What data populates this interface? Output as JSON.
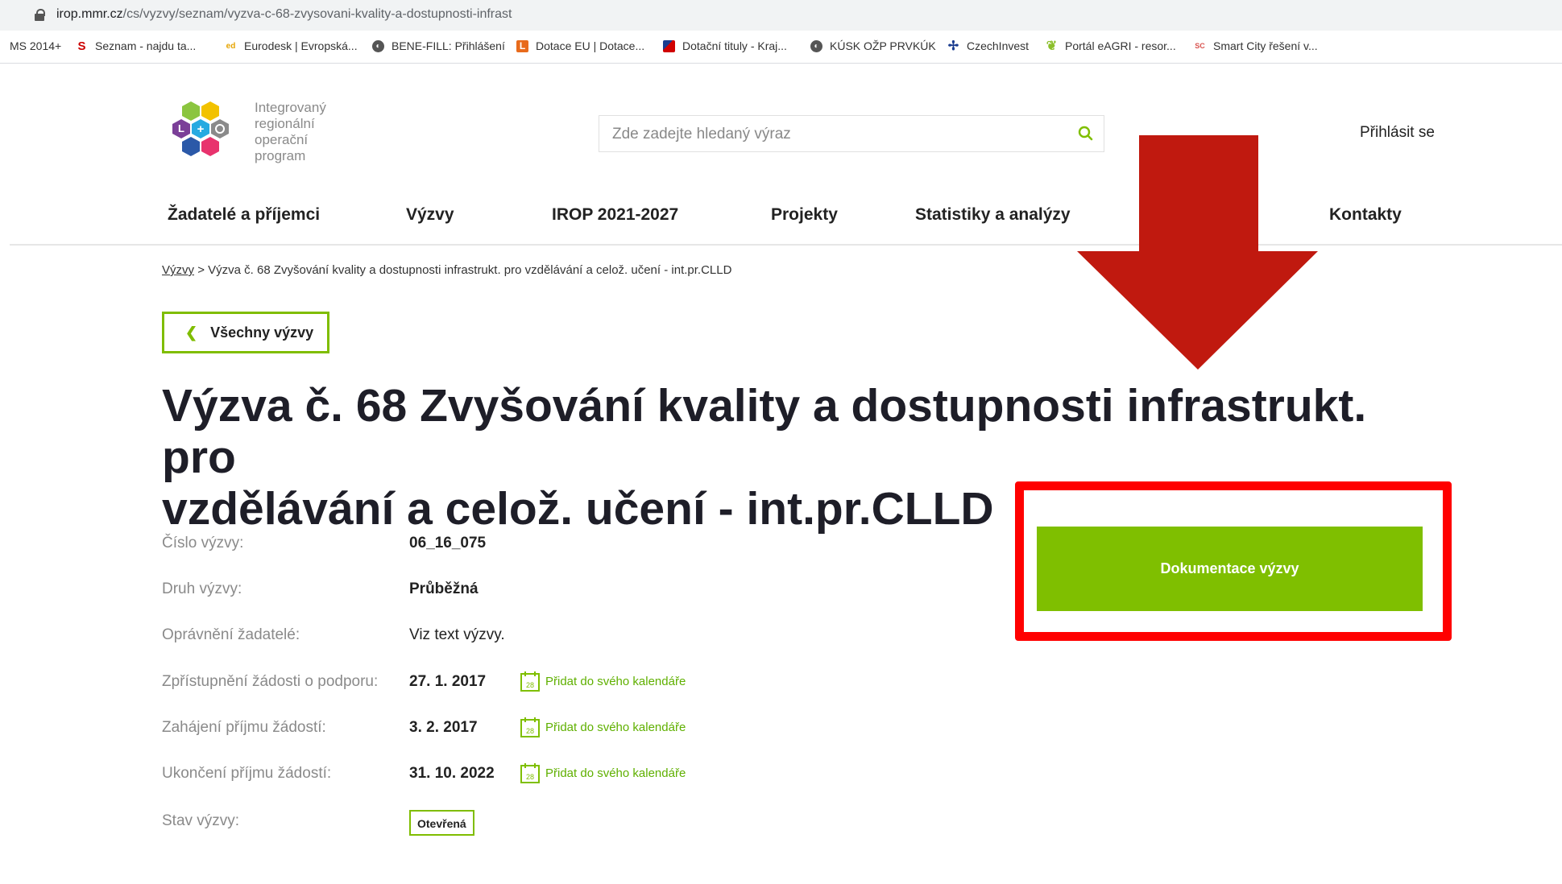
{
  "browser": {
    "url_host": "irop.mmr.cz",
    "url_path": "/cs/vyzvy/seznam/vyzva-c-68-zvysovani-kvality-a-dostupnosti-infrast"
  },
  "bookmarks": [
    {
      "label": "MS 2014+",
      "icon": "none",
      "color": ""
    },
    {
      "label": "Seznam - najdu ta...",
      "icon": "seznam-icon",
      "color": "#cc0000"
    },
    {
      "label": "Eurodesk | Evropská...",
      "icon": "eurodesk-icon",
      "color": "#e6a400"
    },
    {
      "label": "BENE-FILL: Přihlášení",
      "icon": "globe-icon",
      "color": "#555555"
    },
    {
      "label": "Dotace EU | Dotace...",
      "icon": "dotace-icon",
      "color": "#e86b1c"
    },
    {
      "label": "Dotační tituly - Kraj...",
      "icon": "kraj-flag-icon",
      "color": "#d00000"
    },
    {
      "label": "KÚSK OŽP PRVKÚK",
      "icon": "globe-icon",
      "color": "#555555"
    },
    {
      "label": "CzechInvest",
      "icon": "czechinvest-icon",
      "color": "#1a3c8f"
    },
    {
      "label": "Portál eAGRI - resor...",
      "icon": "eagri-icon",
      "color": "#8bbf2a"
    },
    {
      "label": "Smart City řešení v...",
      "icon": "smartcity-icon",
      "color": "#d9534f"
    }
  ],
  "header": {
    "logo_text": [
      "Integrovaný",
      "regionální",
      "operační",
      "program"
    ],
    "search_placeholder": "Zde zadejte hledaný výraz",
    "login": "Přihlásit se"
  },
  "nav": [
    "Žadatelé a příjemci",
    "Výzvy",
    "IROP 2021-2027",
    "Projekty",
    "Statistiky a analýzy",
    "Kontakty"
  ],
  "breadcrumb": {
    "link": "Výzvy",
    "separator": ">",
    "current": "Výzva č. 68 Zvyšování kvality a dostupnosti infrastrukt. pro vzdělávání a celož. učení - int.pr.CLLD"
  },
  "back_button": "Všechny výzvy",
  "title_line1": "Výzva č. 68 Zvyšování kvality a dostupnosti infrastrukt. pro",
  "title_line2": "vzdělávání a celož. učení - int.pr.CLLD",
  "details": {
    "cislo_label": "Číslo výzvy:",
    "cislo_value": "06_16_075",
    "druh_label": "Druh výzvy:",
    "druh_value": "Průběžná",
    "opravneni_label": "Oprávnění žadatelé:",
    "opravneni_value": "Viz text výzvy.",
    "zpristupneni_label": "Zpřístupnění žádosti o podporu:",
    "zpristupneni_value": "27. 1. 2017",
    "zahajeni_label": "Zahájení příjmu žádostí:",
    "zahajeni_value": "3. 2. 2017",
    "ukonceni_label": "Ukončení příjmu žádostí:",
    "ukonceni_value": "31. 10. 2022",
    "stav_label": "Stav výzvy:",
    "stav_value": "Otevřená",
    "calendar_link": "Přidat do svého kalendáře",
    "calendar_day": "28"
  },
  "doc_button": "Dokumentace výzvy",
  "colors": {
    "accent_green": "#7fbf00",
    "highlight_red": "#ff0000",
    "arrow_red": "#c0190f"
  }
}
